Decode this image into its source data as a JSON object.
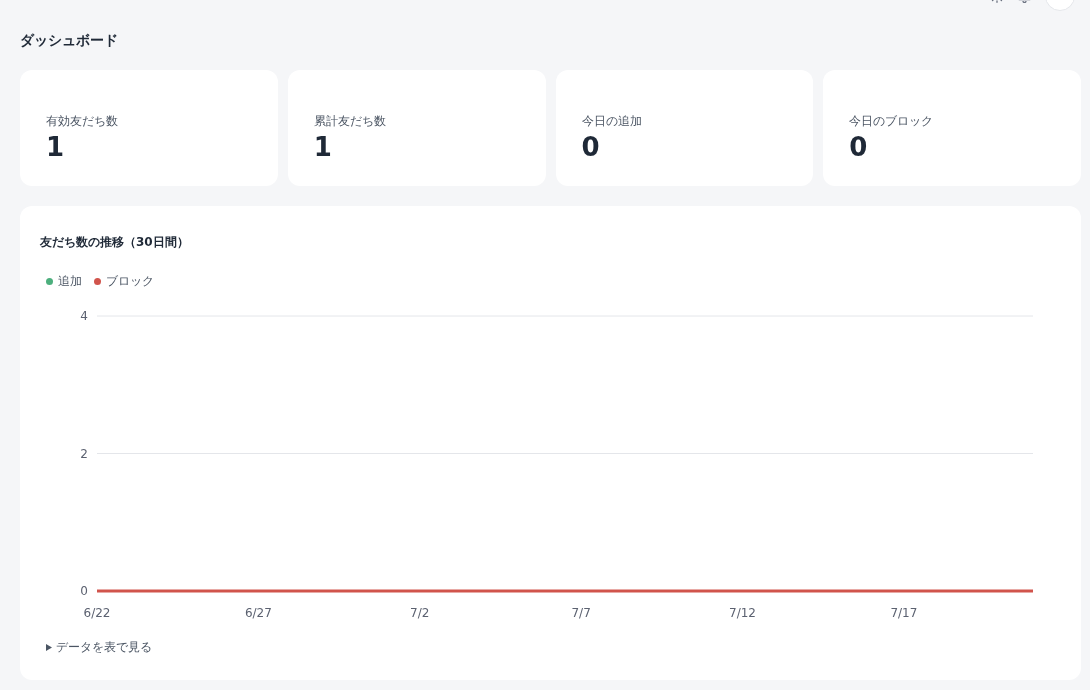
{
  "page_title": "ダッシュボード",
  "stats": [
    {
      "label": "有効友だち数",
      "value": "1"
    },
    {
      "label": "累計友だち数",
      "value": "1"
    },
    {
      "label": "今日の追加",
      "value": "0"
    },
    {
      "label": "今日のブロック",
      "value": "0"
    }
  ],
  "chart": {
    "title": "友だち数の推移（30日間）",
    "chart_data": {
      "type": "line",
      "categories": [
        "6/22",
        null,
        null,
        null,
        null,
        "6/27",
        null,
        null,
        null,
        null,
        "7/2",
        null,
        null,
        null,
        null,
        "7/7",
        null,
        null,
        null,
        null,
        "7/12",
        null,
        null,
        null,
        null,
        "7/17",
        null,
        null,
        null,
        null
      ],
      "series": [
        {
          "name": "追加",
          "color": "#4caf7d",
          "values": [
            null,
            null,
            null,
            null,
            null,
            null,
            null,
            null,
            null,
            null,
            null,
            null,
            null,
            null,
            null,
            null,
            null,
            null,
            null,
            null,
            null,
            null,
            null,
            null,
            null,
            null,
            null,
            null,
            null,
            null
          ]
        },
        {
          "name": "ブロック",
          "color": "#d1544c",
          "values": [
            0,
            0,
            0,
            0,
            0,
            0,
            0,
            0,
            0,
            0,
            0,
            0,
            0,
            0,
            0,
            0,
            0,
            0,
            0,
            0,
            0,
            0,
            0,
            0,
            0,
            0,
            0,
            0,
            0,
            0
          ]
        }
      ],
      "ylim": [
        0,
        4
      ],
      "yticks": [
        0,
        2,
        4
      ]
    },
    "table_toggle": {
      "label": "データを表で見る",
      "expanded": false
    }
  }
}
